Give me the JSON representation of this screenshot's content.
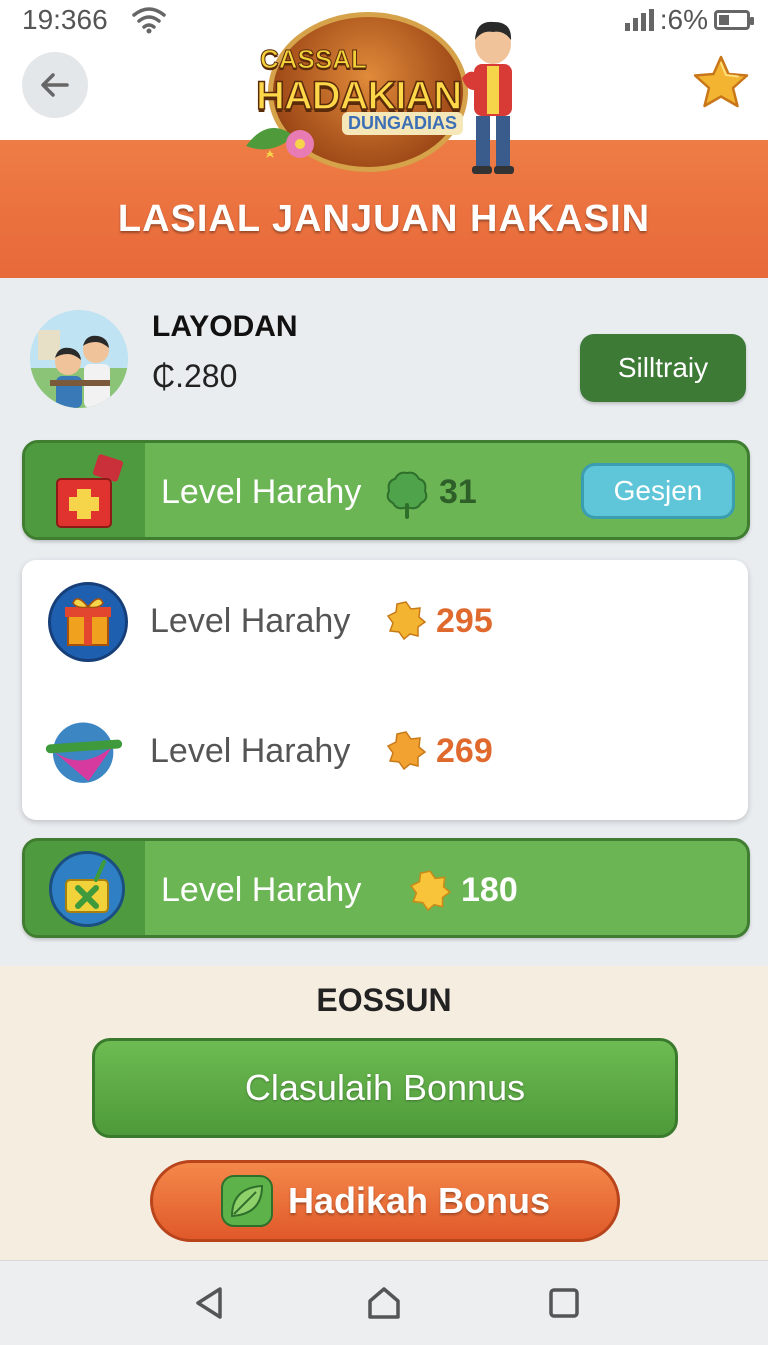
{
  "status_bar": {
    "time": "19:366",
    "battery": ":6%"
  },
  "header": {
    "logo": {
      "line1": "CASSAL",
      "line2": "HADAKIAN",
      "line3": "DUNGADIAS"
    },
    "title": "LASIAL JANJUAN HAKASIN"
  },
  "profile": {
    "name": "LAYODAN",
    "balance": "₵.280",
    "action_label": "Silltraiy"
  },
  "levels": [
    {
      "label": "Level Harahy",
      "value": "31",
      "button_label": "Gesjen"
    },
    {
      "label": "Level Harahy",
      "value": "295"
    },
    {
      "label": "Level Harahy",
      "value": "269"
    },
    {
      "label": "Level Harahy",
      "value": "180"
    }
  ],
  "bonus_section": {
    "title": "EOSSUN",
    "primary_button": "Clasulaih Bonnus",
    "secondary_button": "Hadikah Bonus"
  },
  "colors": {
    "banner": "#e8693a",
    "green": "#6bb555",
    "dark_green": "#3d7a36",
    "orange_value": "#e06a2e",
    "cyan_button": "#5ec6d8"
  },
  "icons": [
    "back-arrow-icon",
    "star-icon",
    "gift-box-icon",
    "clover-icon",
    "gift-icon",
    "gem-icon",
    "basket-icon",
    "leaf-icon"
  ]
}
